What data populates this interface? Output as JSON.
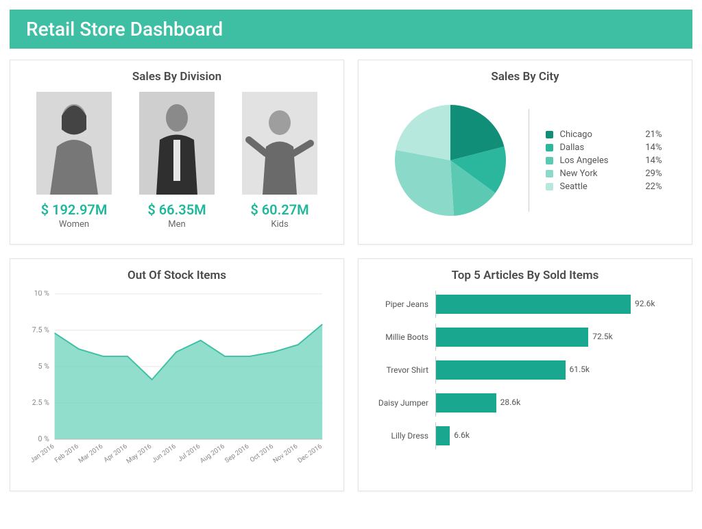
{
  "header": {
    "title": "Retail Store Dashboard"
  },
  "colors": {
    "accent": "#3ebfa4",
    "value": "#1fb89c",
    "bar": "#1aa790",
    "area_fill": "#7dd8c2",
    "area_stroke": "#3ebfa4",
    "pie": [
      "#118e77",
      "#2bb79d",
      "#5cc9b3",
      "#8bd9c8",
      "#b6e8dd"
    ]
  },
  "sales_by_division": {
    "title": "Sales By Division",
    "items": [
      {
        "name": "Women",
        "value": "$ 192.97M"
      },
      {
        "name": "Men",
        "value": "$ 66.35M"
      },
      {
        "name": "Kids",
        "value": "$ 60.27M"
      }
    ]
  },
  "sales_by_city": {
    "title": "Sales By City",
    "items": [
      {
        "name": "Chicago",
        "pct": 21
      },
      {
        "name": "Dallas",
        "pct": 14
      },
      {
        "name": "Los Angeles",
        "pct": 14
      },
      {
        "name": "New York",
        "pct": 29
      },
      {
        "name": "Seattle",
        "pct": 22
      }
    ]
  },
  "out_of_stock": {
    "title": "Out Of Stock Items",
    "y_ticks": [
      "0 %",
      "2.5 %",
      "5 %",
      "7.5 %",
      "10 %"
    ],
    "x_labels": [
      "Jan 2016",
      "Feb 2016",
      "Mar 2016",
      "Apr 2016",
      "May 2016",
      "Jun 2016",
      "Jul 2016",
      "Aug 2016",
      "Sep 2016",
      "Oct 2016",
      "Nov 2016",
      "Dec 2016"
    ]
  },
  "top_articles": {
    "title": "Top 5 Articles By Sold Items",
    "items": [
      {
        "name": "Piper Jeans",
        "value": 92.6,
        "label": "92.6k"
      },
      {
        "name": "Millie Boots",
        "value": 72.5,
        "label": "72.5k"
      },
      {
        "name": "Trevor Shirt",
        "value": 61.5,
        "label": "61.5k"
      },
      {
        "name": "Daisy Jumper",
        "value": 28.6,
        "label": "28.6k"
      },
      {
        "name": "Lilly Dress",
        "value": 6.6,
        "label": "6.6k"
      }
    ]
  },
  "chart_data": [
    {
      "type": "pie",
      "title": "Sales By City",
      "series": [
        {
          "name": "Chicago",
          "value": 21
        },
        {
          "name": "Dallas",
          "value": 14
        },
        {
          "name": "Los Angeles",
          "value": 14
        },
        {
          "name": "New York",
          "value": 29
        },
        {
          "name": "Seattle",
          "value": 22
        }
      ]
    },
    {
      "type": "area",
      "title": "Out Of Stock Items",
      "xlabel": "",
      "ylabel": "",
      "ylim": [
        0,
        10
      ],
      "categories": [
        "Jan 2016",
        "Feb 2016",
        "Mar 2016",
        "Apr 2016",
        "May 2016",
        "Jun 2016",
        "Jul 2016",
        "Aug 2016",
        "Sep 2016",
        "Oct 2016",
        "Nov 2016",
        "Dec 2016"
      ],
      "values": [
        7.3,
        6.2,
        5.7,
        5.7,
        4.1,
        6.0,
        6.8,
        5.7,
        5.7,
        6.0,
        6.5,
        7.9
      ]
    },
    {
      "type": "bar",
      "title": "Top 5 Articles By Sold Items",
      "orientation": "horizontal",
      "xlabel": "",
      "ylabel": "",
      "xlim": [
        0,
        100
      ],
      "categories": [
        "Piper Jeans",
        "Millie Boots",
        "Trevor Shirt",
        "Daisy Jumper",
        "Lilly Dress"
      ],
      "values": [
        92.6,
        72.5,
        61.5,
        28.6,
        6.6
      ]
    }
  ]
}
